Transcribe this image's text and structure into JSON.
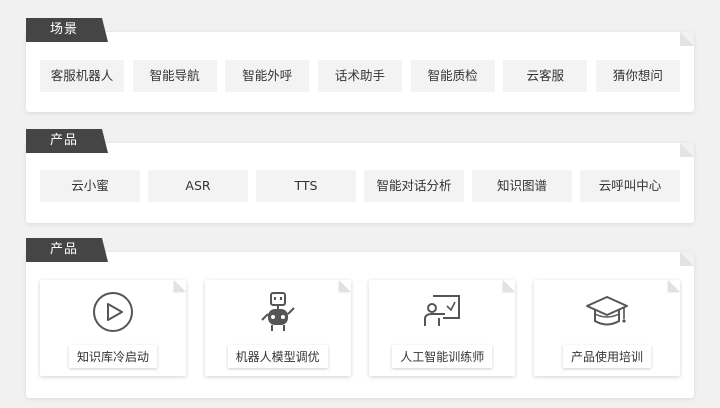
{
  "scenes": {
    "tag": "场景",
    "items": [
      "客服机器人",
      "智能导航",
      "智能外呼",
      "话术助手",
      "智能质检",
      "云客服",
      "猜你想问"
    ]
  },
  "products": {
    "tag": "产品",
    "items": [
      "云小蜜",
      "ASR",
      "TTS",
      "智能对话分析",
      "知识图谱",
      "云呼叫中心"
    ]
  },
  "services": {
    "tag": "产品",
    "cards": [
      {
        "label": "知识库冷启动",
        "icon": "play-circle-icon"
      },
      {
        "label": "机器人模型调优",
        "icon": "robot-icon"
      },
      {
        "label": "人工智能训练师",
        "icon": "teacher-board-icon"
      },
      {
        "label": "产品使用培训",
        "icon": "graduation-cap-icon"
      }
    ]
  },
  "colors": {
    "tag_bg": "#454545",
    "chip_bg": "#f3f3f4",
    "page_bg": "#f1f1f1"
  }
}
